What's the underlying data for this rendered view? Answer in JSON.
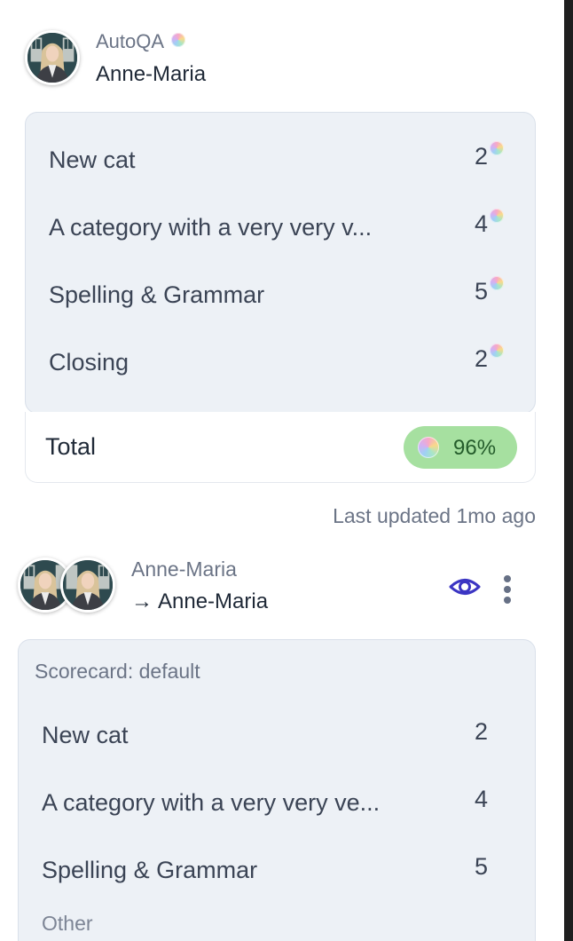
{
  "autoqa_review": {
    "source": "AutoQA",
    "reviewee": "Anne-Maria",
    "categories": [
      {
        "label": "New cat",
        "score": "2"
      },
      {
        "label": "A category with a very very v...",
        "score": "4"
      },
      {
        "label": "Spelling & Grammar",
        "score": "5"
      },
      {
        "label": "Closing",
        "score": "2"
      }
    ],
    "total_label": "Total",
    "total_score": "96%",
    "total_color": "#a6e0a0",
    "last_updated": "Last updated 1mo ago"
  },
  "manual_review": {
    "reviewer": "Anne-Maria",
    "arrow": "→",
    "reviewee": "Anne-Maria",
    "scorecard_title": "Scorecard: default",
    "categories": [
      {
        "label": "New cat",
        "score": "2"
      },
      {
        "label": "A category with a very very ve...",
        "score": "4"
      },
      {
        "label": "Spelling & Grammar",
        "score": "5"
      }
    ],
    "group_label": "Other",
    "icons": [
      "eye-icon",
      "more-vertical-icon"
    ],
    "accent_color": "#3b35c3"
  }
}
